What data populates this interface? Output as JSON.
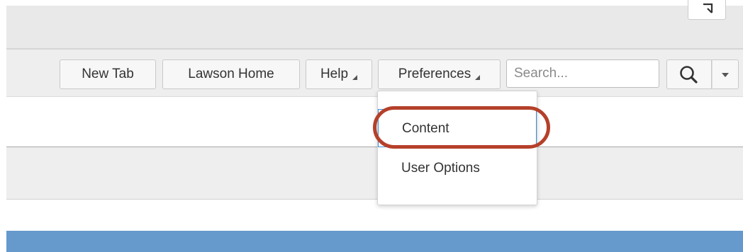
{
  "header": {
    "popout_icon": "popout-icon"
  },
  "toolbar": {
    "new_tab_label": "New Tab",
    "lawson_home_label": "Lawson Home",
    "help_label": "Help",
    "preferences_label": "Preferences",
    "search_placeholder": "Search...",
    "search_value": "",
    "search_icon": "magnifier-icon",
    "search_dropdown_icon": "chevron-down-icon"
  },
  "preferences_menu": {
    "items": [
      {
        "label": "Content",
        "focused": true
      },
      {
        "label": "User Options",
        "focused": false
      }
    ]
  },
  "colors": {
    "accent_blue": "#6699cc",
    "focus_border": "#3a8fd9",
    "annotation_ring": "#b5402a",
    "toolbar_background": "#eeeeee"
  }
}
